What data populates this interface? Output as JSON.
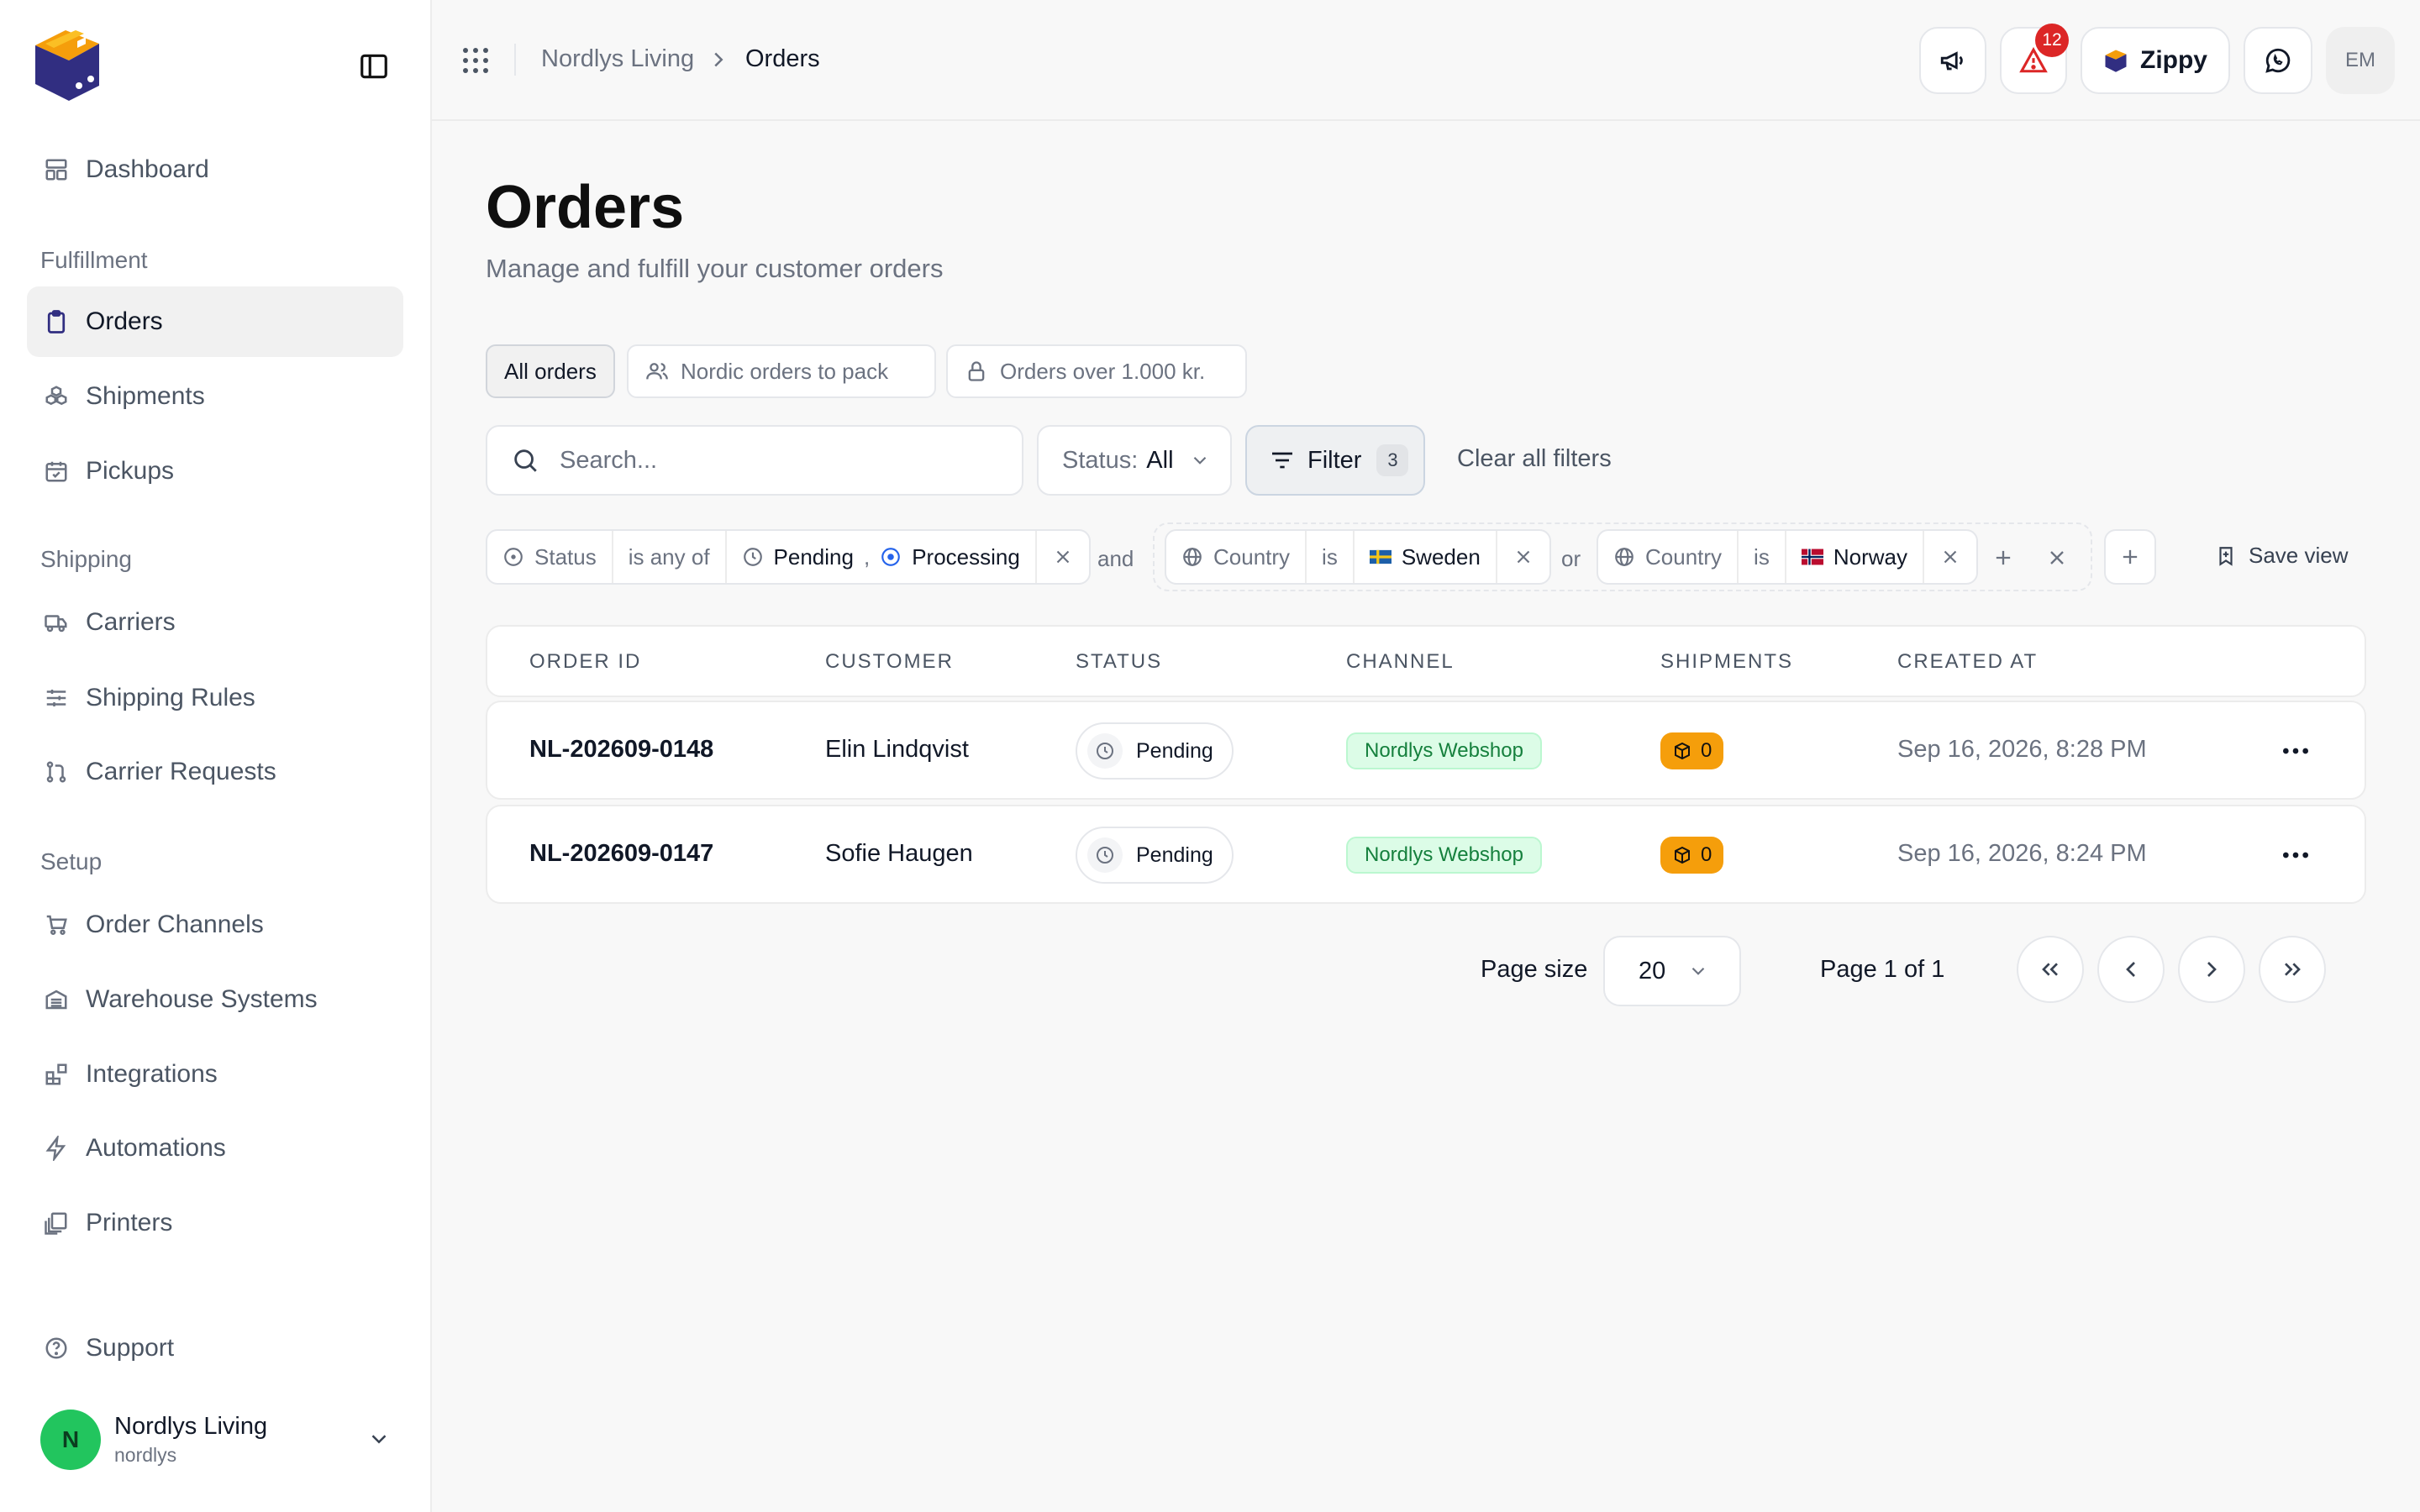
{
  "colors": {
    "brand_primary": "#312e81",
    "brand_accent": "#f59e0b",
    "alert_badge": "#dc2626",
    "channel_green": "#15803d",
    "workspace_avatar": "#22c55e"
  },
  "sidebar": {
    "toggle_icon": "sidebar-toggle-icon",
    "dashboard": {
      "label": "Dashboard",
      "icon": "layout-grid-icon"
    },
    "sections": [
      {
        "title": "Fulfillment",
        "items": [
          {
            "label": "Orders",
            "icon": "clipboard-icon",
            "active": true
          },
          {
            "label": "Shipments",
            "icon": "boxes-icon"
          },
          {
            "label": "Pickups",
            "icon": "calendar-check-icon"
          }
        ]
      },
      {
        "title": "Shipping",
        "items": [
          {
            "label": "Carriers",
            "icon": "truck-icon"
          },
          {
            "label": "Shipping Rules",
            "icon": "sliders-icon"
          },
          {
            "label": "Carrier Requests",
            "icon": "git-pull-icon"
          }
        ]
      },
      {
        "title": "Setup",
        "items": [
          {
            "label": "Order Channels",
            "icon": "shopping-cart-icon"
          },
          {
            "label": "Warehouse Systems",
            "icon": "warehouse-icon"
          },
          {
            "label": "Integrations",
            "icon": "blocks-icon"
          },
          {
            "label": "Automations",
            "icon": "lightning-icon"
          },
          {
            "label": "Printers",
            "icon": "copies-icon"
          }
        ]
      }
    ],
    "support": {
      "label": "Support",
      "icon": "help-circle-icon"
    },
    "workspace": {
      "initial": "N",
      "name": "Nordlys Living",
      "slug": "nordlys"
    }
  },
  "header": {
    "breadcrumb": [
      "Nordlys Living",
      "Orders"
    ],
    "notification_count": "12",
    "brand_button_label": "Zippy",
    "user_initials": "EM"
  },
  "page": {
    "title": "Orders",
    "subtitle": "Manage and fulfill your customer orders"
  },
  "views": [
    {
      "label": "All orders",
      "active": true
    },
    {
      "label": "Nordic orders to pack",
      "icon": "users-icon"
    },
    {
      "label": "Orders over 1.000 kr.",
      "icon": "lock-icon"
    }
  ],
  "toolbar": {
    "search_placeholder": "Search...",
    "status_label": "Status:",
    "status_value": "All",
    "filter_label": "Filter",
    "filter_count": "3",
    "clear_label": "Clear all filters"
  },
  "filters": {
    "status": {
      "field": "Status",
      "operator": "is any of",
      "value_1": "Pending",
      "separator": ",",
      "value_2": "Processing"
    },
    "and_label": "and",
    "country_1": {
      "field": "Country",
      "operator": "is",
      "value": "Sweden"
    },
    "or_label": "or",
    "country_2": {
      "field": "Country",
      "operator": "is",
      "value": "Norway"
    },
    "save_view_label": "Save view"
  },
  "table": {
    "columns": [
      "ORDER ID",
      "CUSTOMER",
      "STATUS",
      "CHANNEL",
      "SHIPMENTS",
      "CREATED AT"
    ],
    "rows": [
      {
        "order_id": "NL-202609-0148",
        "customer": "Elin Lindqvist",
        "status": "Pending",
        "channel": "Nordlys Webshop",
        "shipments": "0",
        "created_at": "Sep 16, 2026, 8:28 PM"
      },
      {
        "order_id": "NL-202609-0147",
        "customer": "Sofie Haugen",
        "status": "Pending",
        "channel": "Nordlys Webshop",
        "shipments": "0",
        "created_at": "Sep 16, 2026, 8:24 PM"
      }
    ]
  },
  "pagination": {
    "page_size_label": "Page size",
    "page_size": "20",
    "page_info": "Page 1 of 1"
  }
}
